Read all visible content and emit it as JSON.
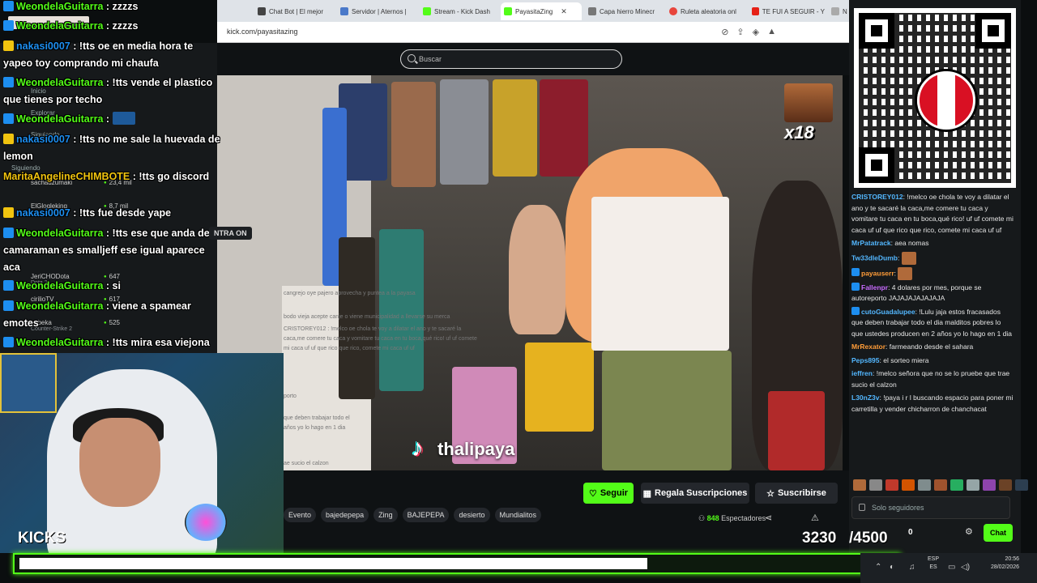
{
  "browser": {
    "tabs": [
      {
        "label": "Chat Bot | El mejor",
        "color": "#444"
      },
      {
        "label": "Servidor | Aternos |",
        "color": "#4a79c9"
      },
      {
        "label": "Stream - Kick Dash",
        "color": "#53fc18"
      },
      {
        "label": "PayasitaZing",
        "color": "#53fc18"
      },
      {
        "label": "Capa hierro Minecr",
        "color": "#777"
      },
      {
        "label": "Ruleta aleatoria onl",
        "color": "#e8453c"
      },
      {
        "label": "TE FUI A SEGUIR - Y",
        "color": "#e62117"
      },
      {
        "label": "N",
        "color": "#aaa"
      }
    ],
    "close_glyph": "✕",
    "url": "kick.com/payasitazing"
  },
  "search": {
    "placeholder": "Buscar"
  },
  "sidebar": {
    "nav": [
      "Inicio",
      "Explorar",
      "Siguiendo"
    ],
    "section_following": "Siguiendo",
    "recommended": [
      {
        "name": "sachadzumaki",
        "game": "",
        "count": "23,4 mil"
      },
      {
        "name": "ElGlogleking",
        "game": "",
        "count": "8,7 mil"
      },
      {
        "name": "JeriCHODota",
        "game": "Dota 2",
        "count": "647"
      },
      {
        "name": "cirilioTV",
        "game": "",
        "count": "617"
      },
      {
        "name": "zobeka",
        "game": "Counter-Strike 2",
        "count": "525"
      }
    ]
  },
  "overlay_chat": [
    {
      "user": "WeondelaGuitarra",
      "badge": "blue",
      "text": ": zzzzs"
    },
    {
      "user": "WeondelaGuitarra",
      "badge": "blue",
      "text": ": zzzzs"
    },
    {
      "user": "nakasi0007",
      "badge": "gold",
      "text": ": !tts oe en media hora te yapeo toy comprando mi chaufa"
    },
    {
      "user": "WeondelaGuitarra",
      "badge": "blue",
      "text": ": !tts vende el plastico que tienes por techo"
    },
    {
      "user": "WeondelaGuitarra",
      "badge": "blue",
      "text": ":"
    },
    {
      "user": "nakasi0007",
      "badge": "gold",
      "text": ": !tts no me sale la huevada de lemon"
    },
    {
      "user": "MaritaAngelineCHIMBOTE",
      "badge": "",
      "text": ": !tts go discord"
    },
    {
      "user": "nakasi0007",
      "badge": "gold",
      "text": ": !tts fue desde yape"
    },
    {
      "user": "WeondelaGuitarra",
      "badge": "blue",
      "text": ": !tts ese que anda de camaraman es smalljeff ese igual aparece aca"
    },
    {
      "user": "WeondelaGuitarra",
      "badge": "blue",
      "text": ": si"
    },
    {
      "user": "WeondelaGuitarra",
      "badge": "blue",
      "text": ": viene a spamear emotes"
    },
    {
      "user": "WeondelaGuitarra",
      "badge": "blue",
      "text": ": !tts mira esa viejona no esta para andar con ese vestido"
    }
  ],
  "banner": "NTRA ON",
  "video": {
    "watermark": "thalipaya",
    "x18_label": "x18",
    "faded_lines": [
      "cangrejo oye pajero aprovecha y puntea a la payasa",
      "bodo vieja acepte canje o viene municipalidad a llevarse su merca",
      "CRISTOREY012 : !melco oe chola te voy a dilatar el ano y te sacaré la",
      "caca,me comere tu caca y vomitare tu caca en tu boca,qué rico! uf uf comete",
      "mi caca uf uf que rico que rico, comete mi caca uf uf",
      "porto",
      "que deben trabajar todo el",
      "años yo lo hago en 1 dia",
      "ae sucio el calzon"
    ]
  },
  "stream_actions": {
    "follow": "Seguir",
    "gift": "Regala Suscripciones",
    "subscribe": "Suscribirse"
  },
  "tags": [
    "Evento",
    "bajedepepa",
    "Zing",
    "BAJEPEPA",
    "desierto",
    "Mundialitos"
  ],
  "viewers": {
    "count": "848",
    "label": "Espectadores"
  },
  "right_chat": [
    {
      "user": "CRISTOREY012",
      "color": "#53b7ff",
      "text": ": !melco oe chola te voy a dilatar el ano y te sacaré la caca,me comere tu caca y vomitare tu caca en tu boca,qué rico! uf uf comete mi caca uf uf que rico que rico, comete mi caca uf uf"
    },
    {
      "user": "MrPatatrack",
      "color": "#53b7ff",
      "text": ": aea nomas"
    },
    {
      "user": "Tw33dleDumb",
      "color": "#53b7ff",
      "text": ":"
    },
    {
      "user": "payauserr",
      "color": "#ff9c38",
      "text": ":"
    },
    {
      "user": "Fallenpr",
      "color": "#c86bff",
      "text": ": 4 dolares por mes, porque se autoreporto JAJAJAJAJAJAJA"
    },
    {
      "user": "cutoGuadalupee",
      "color": "#53b7ff",
      "text": ": !Lulu jaja estos fracasados que deben trabajar todo el dia malditos pobres lo que ustedes producen en 2 años yo lo hago en 1 dia"
    },
    {
      "user": "MrRexator",
      "color": "#ff9c38",
      "text": ": farmeando desde el sahara"
    },
    {
      "user": "Peps895",
      "color": "#53b7ff",
      "text": ": el sorteo miera"
    },
    {
      "user": "ieffren",
      "color": "#53b7ff",
      "text": ": !melco señora que no se lo pruebe que trae sucio el calzon"
    },
    {
      "user": "L30nZ3v",
      "color": "#53b7ff",
      "text": ": !paya i r l buscando espacio para poner mi carretilla y vender chicharron de chanchacat"
    }
  ],
  "chat_input": {
    "placeholder": "Solo seguidores"
  },
  "chat_footer": {
    "count": "0",
    "send": "Chat"
  },
  "cam": {
    "label": "KICKS"
  },
  "goal": {
    "current": "3230",
    "target": "/4500",
    "progress": 0.718
  },
  "taskbar": {
    "lang_1": "ESP",
    "lang_2": "ES",
    "time": "20:56",
    "date": "28/02/2026"
  },
  "colors": {
    "kick_green": "#53fc18",
    "chat_bg": "#16191b"
  }
}
